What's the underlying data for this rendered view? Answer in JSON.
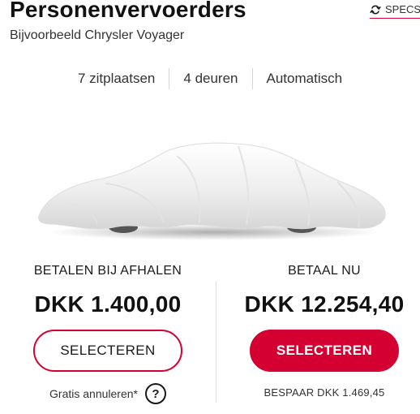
{
  "card": {
    "title": "Personenvervoerders",
    "subtitle": "Bijvoorbeeld Chrysler Voyager",
    "specs_label": "SPECS",
    "specs_icon": "arrows-exchange-icon",
    "features": [
      "7 zitplaatsen",
      "4 deuren",
      "Automatisch"
    ],
    "image_description": "car-under-cover-placeholder"
  },
  "pay_at_pickup": {
    "label": "BETALEN BIJ AFHALEN",
    "price": "DKK 1.400,00",
    "button_label": "SELECTEREN",
    "note": "Gratis annuleren*",
    "help_icon": "question-mark-icon"
  },
  "pay_now": {
    "label": "BETAAL NU",
    "price": "DKK 12.254,40",
    "button_label": "SELECTEREN",
    "savings": "BESPAAR DKK 1.469,45"
  },
  "colors": {
    "accent": "#d50032",
    "text": "#1a1a1a",
    "divider": "#d4d4d4"
  }
}
